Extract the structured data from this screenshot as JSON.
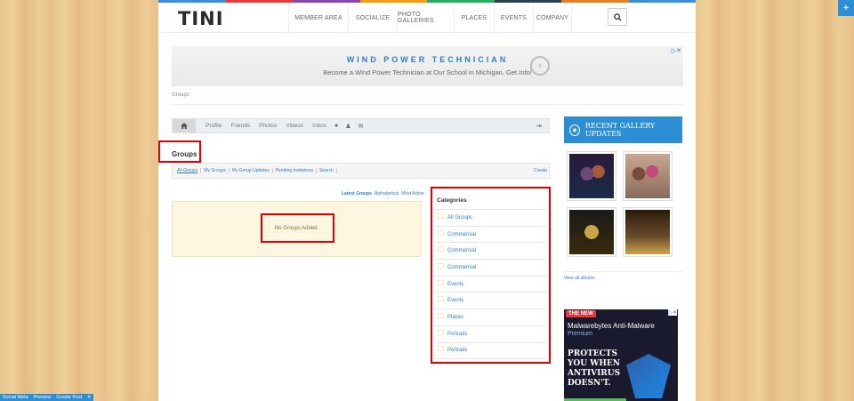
{
  "colors": {
    "accent": "#2c8fd6",
    "highlight": "#e00000",
    "folder": "#e8a317",
    "notice_bg": "#fdf6e0"
  },
  "colorbar": [
    "#3a8fd6",
    "#e53935",
    "#8e44ad",
    "#f39c12",
    "#27ae60",
    "#2c3e50",
    "#e67e22",
    "#3a8fd6"
  ],
  "logo": "TINI",
  "nav": [
    {
      "label": "MEMBER AREA",
      "width": 67
    },
    {
      "label": "SOCIALIZE",
      "width": 55
    },
    {
      "label": "PHOTO GALLERIES",
      "width": 64
    },
    {
      "label": "PLACES",
      "width": 45
    },
    {
      "label": "EVENTS",
      "width": 44
    },
    {
      "label": "COMPANY",
      "width": 44
    }
  ],
  "ad": {
    "title": "WIND POWER TECHNICIAN",
    "subtitle": "Become a Wind Power Technician at Our School in Michigan. Get Info!",
    "choice": "▷✕"
  },
  "breadcrumb": "Groups",
  "profile_bar": {
    "items": [
      "Profile",
      "Friends",
      "Photos",
      "Videos",
      "Inbox"
    ]
  },
  "page_title": "Groups",
  "subtabs": [
    "All Groups",
    "My Groups",
    "My Group Updates",
    "Pending Invitations",
    "Search"
  ],
  "create_label": "Create",
  "sort": {
    "latest": "Latest Groups",
    "alpha": "Alphabetical",
    "active": "Most Active"
  },
  "notice": "No Groups Added.",
  "categories": {
    "title": "Categories",
    "items": [
      "All Groups",
      "Commercial",
      "Commercial",
      "Commercial",
      "Events",
      "Events",
      "Places",
      "Portraits",
      "Portraits"
    ]
  },
  "sidebar": {
    "heading": "RECENT GALLERY UPDATES",
    "view_all": "View all albums"
  },
  "ad2": {
    "new": "THE NEW",
    "brand": "Malwarebytes Anti-Malware",
    "premium": "Premium",
    "lines": [
      "PROTECTS",
      "YOU WHEN",
      "ANTIVIRUS",
      "DOESN'T."
    ],
    "close": "▷✕"
  },
  "corner_button": "+",
  "bottom_bar": [
    "Social Meta",
    "Preview",
    "Create Post",
    "X"
  ]
}
